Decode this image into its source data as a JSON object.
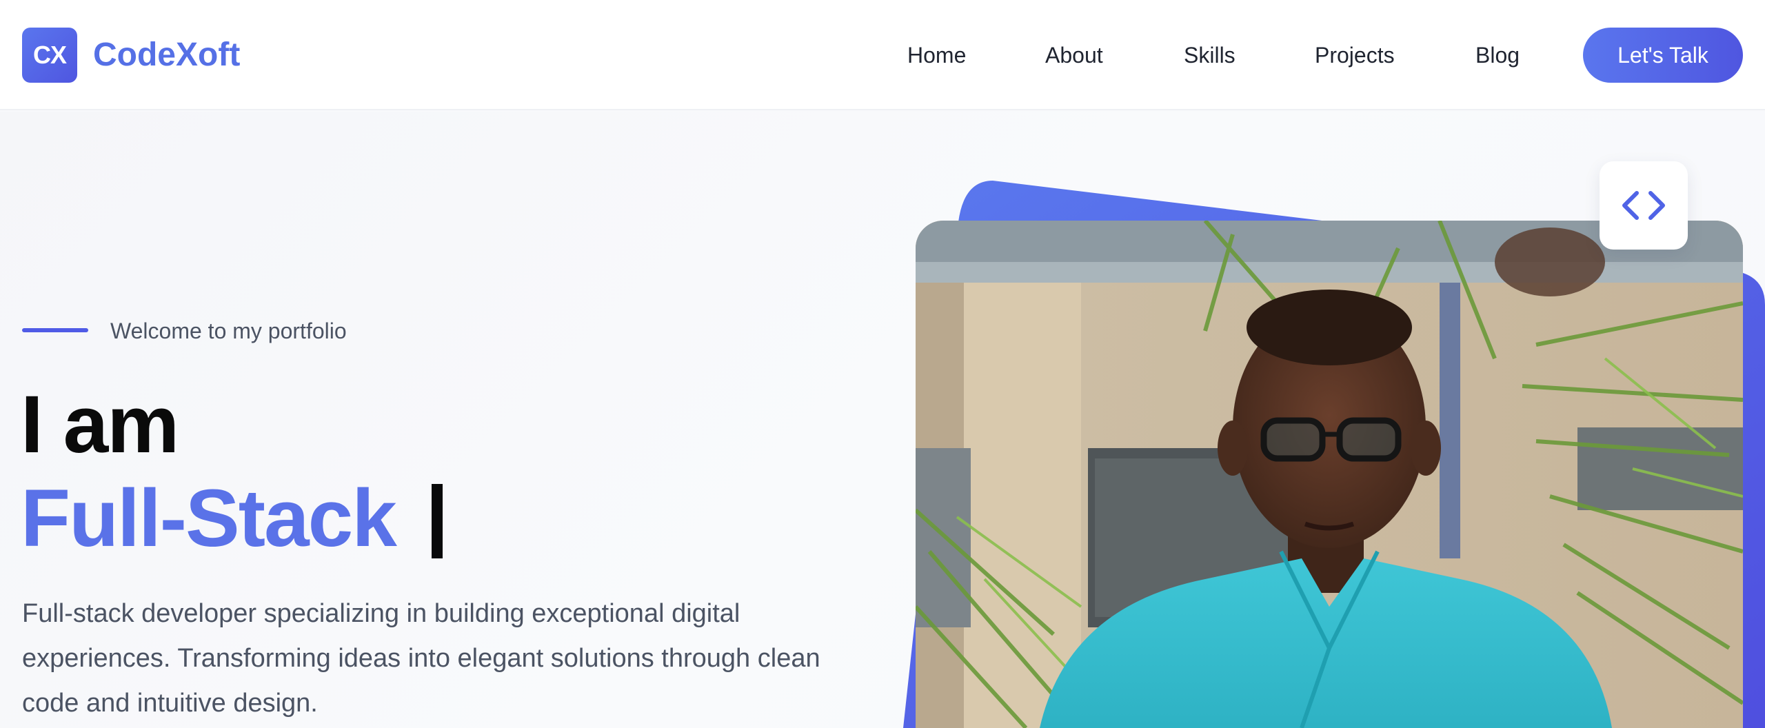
{
  "brand": {
    "badge": "CX",
    "name": "CodeXoft",
    "accent_color": "#5570e6"
  },
  "nav": {
    "items": [
      {
        "label": "Home"
      },
      {
        "label": "About"
      },
      {
        "label": "Skills"
      },
      {
        "label": "Projects"
      },
      {
        "label": "Blog"
      }
    ],
    "cta_label": "Let's Talk"
  },
  "hero": {
    "eyebrow": "Welcome to my portfolio",
    "headline_line1": "I am",
    "headline_role": "Full-Stack",
    "description": "Full-stack developer specializing in building exceptional digital experiences. Transforming ideas into elegant solutions through clean code and intuitive design.",
    "photo_alt_icon": "person-photo",
    "code_chip_icon": "code-brackets-icon"
  }
}
